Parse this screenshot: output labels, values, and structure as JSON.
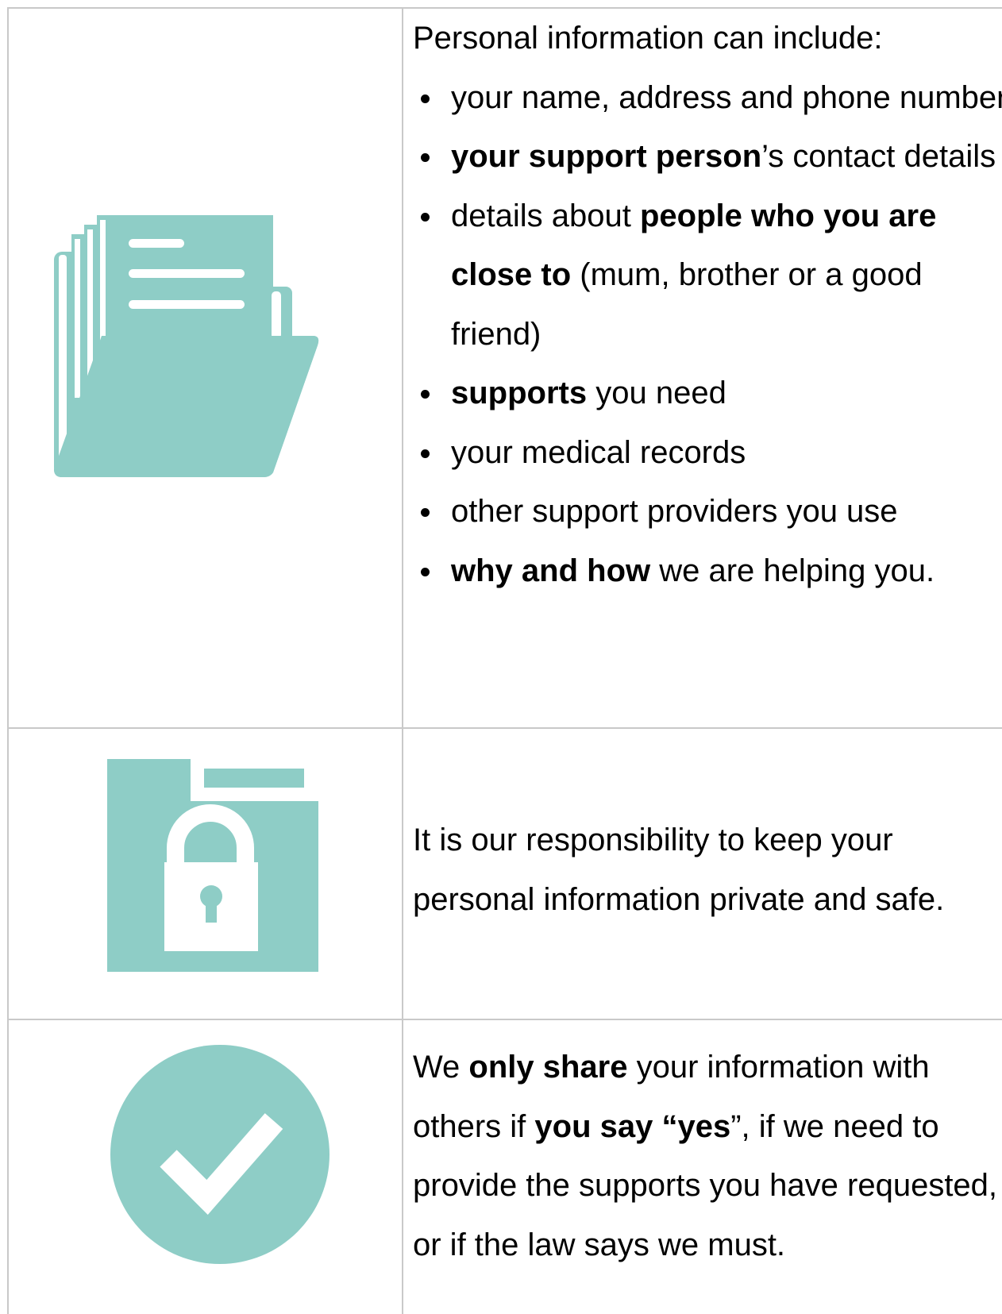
{
  "colors": {
    "accent": "#8ecdc6",
    "border": "#c9c9c9",
    "text": "#000000"
  },
  "rows": [
    {
      "icon": "open-folder-documents-icon",
      "intro": "Personal information can include:",
      "items": [
        {
          "pre": "",
          "bold": "",
          "post": "your name, address and phone number"
        },
        {
          "pre": "",
          "bold": "your support person",
          "post": "’s contact details"
        },
        {
          "pre": "details about ",
          "bold": "people who you are close to",
          "post": " (mum, brother or a good friend)"
        },
        {
          "pre": "",
          "bold": "supports",
          "post": " you need"
        },
        {
          "pre": "",
          "bold": "",
          "post": "your medical records"
        },
        {
          "pre": "",
          "bold": "",
          "post": "other support providers you use"
        },
        {
          "pre": "",
          "bold": "why and how",
          "post": " we are helping you."
        }
      ]
    },
    {
      "icon": "locked-folder-icon",
      "text": "It is our responsibility to keep your personal information private and safe."
    },
    {
      "icon": "checkmark-circle-icon",
      "t1": "We ",
      "b1": "only share",
      "t2": " your information with others if ",
      "b2": "you say “yes",
      "t3": "”, if we need to provide the supports you have requested, or if the law says we must."
    }
  ]
}
